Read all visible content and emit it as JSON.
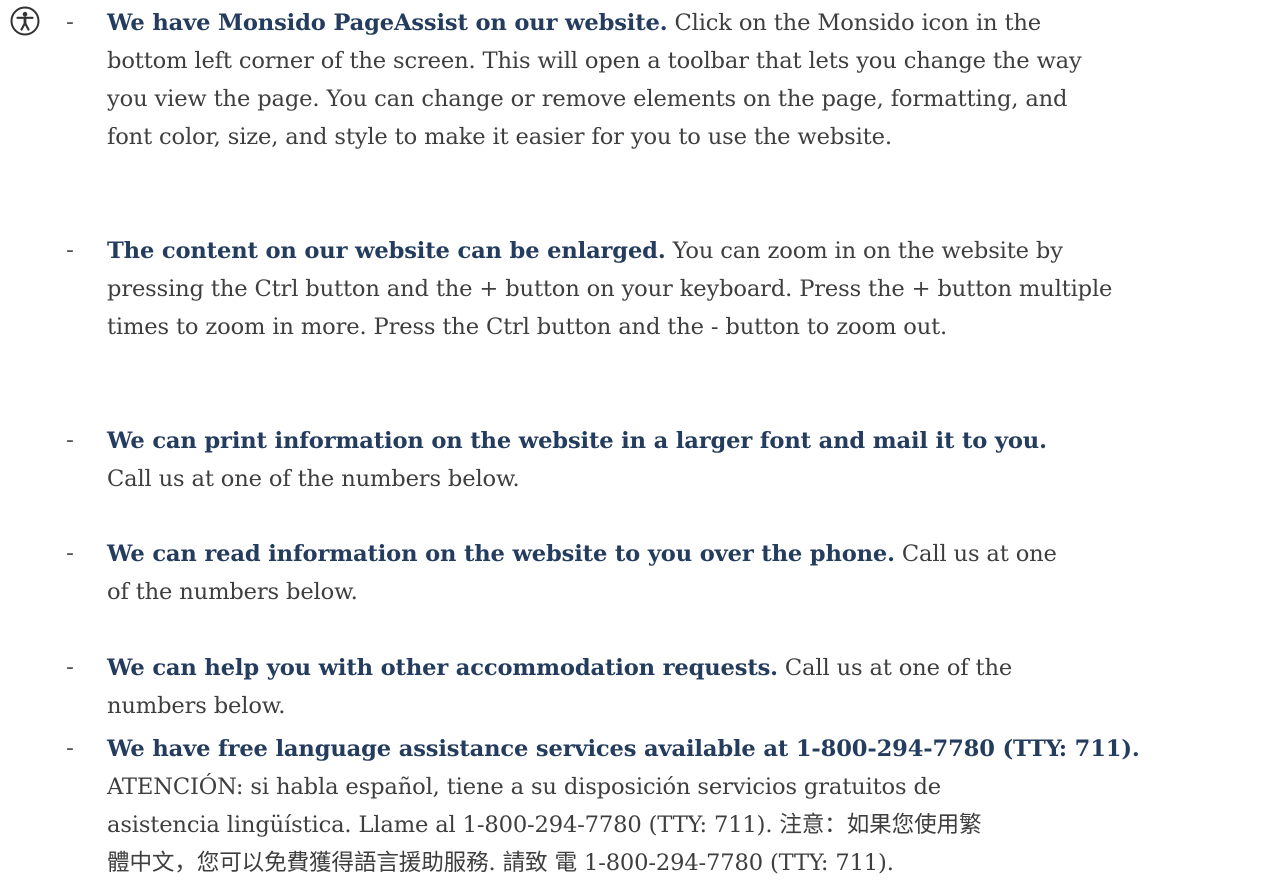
{
  "items": [
    {
      "lead": "We have Monsido PageAssist on our website.",
      "lines": [
        " Click on the Monsido icon in the",
        "bottom left corner of the screen. This will open a toolbar that lets you change the way",
        "you view the page. You can change or remove elements on the page, formatting, and",
        "font color, size, and style to make it easier for you to use the website."
      ]
    },
    {
      "lead": "The content on our website can be enlarged.",
      "lines": [
        "  You can zoom in on the website by",
        "pressing the Ctrl button and the + button on your keyboard. Press the + button multiple",
        "times to zoom in more. Press the Ctrl button and the - button to zoom out."
      ]
    },
    {
      "lead": "We can print information on the website in a larger font and mail it to you.",
      "lines": [
        "",
        "Call us at one of the numbers below."
      ]
    },
    {
      "lead": "We can read information on the website to you over the phone.",
      "lines": [
        " Call us at one",
        "of the numbers below."
      ]
    },
    {
      "lead": "We can help you with other accommodation requests.",
      "lines": [
        " Call us at one of the",
        "numbers below."
      ]
    },
    {
      "lead": "We have free language assistance services available at 1-800-294-7780 (TTY: 711).",
      "lines": [
        "",
        "ATENCIÓN: si habla español, tiene a su disposición servicios gratuitos de",
        "asistencia lingüística. Llame al 1-800-294-7780 (TTY: 711). 注意：如果您使用繁",
        "體中文，您可以免費獲得語言援助服務. 請致 電 1-800-294-7780 (TTY: 711)."
      ]
    }
  ],
  "dash": "-",
  "icon": "accessibility-icon",
  "colors": {
    "lead": "#243c5e",
    "body": "#3e3e3e"
  }
}
